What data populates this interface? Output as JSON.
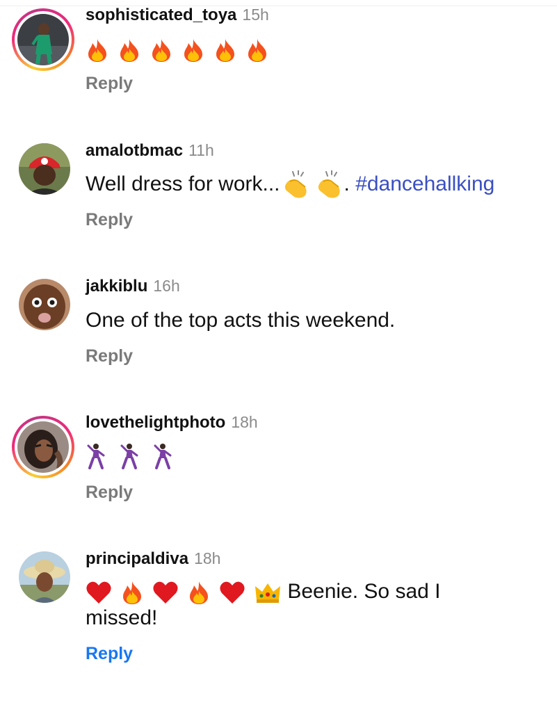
{
  "comments": [
    {
      "username": "sophisticated_toya",
      "time": "15h",
      "text": "",
      "emoji": [
        "fire-icon",
        "fire-icon",
        "fire-icon",
        "fire-icon",
        "fire-icon",
        "fire-icon"
      ],
      "reply": "Reply",
      "story_ring": true
    },
    {
      "username": "amalotbmac",
      "time": "11h",
      "text": "Well dress for work...",
      "text_after_emoji": ". ",
      "hashtag": "#dancehallking",
      "emoji": [
        "clapping-hands-icon",
        "clapping-hands-icon"
      ],
      "reply": "Reply",
      "story_ring": false
    },
    {
      "username": "jakkiblu",
      "time": "16h",
      "text": "One of the top acts this weekend.",
      "reply": "Reply",
      "story_ring": false
    },
    {
      "username": "lovethelightphoto",
      "time": "18h",
      "text": "",
      "emoji": [
        "man-dancing-icon",
        "man-dancing-icon",
        "man-dancing-icon"
      ],
      "reply": "Reply",
      "story_ring": true
    },
    {
      "username": "principaldiva",
      "time": "18h",
      "emoji": [
        "red-heart-icon",
        "fire-icon",
        "red-heart-icon",
        "fire-icon",
        "red-heart-icon",
        "crown-icon"
      ],
      "text": " Beenie. So sad I",
      "text_line2": "missed!",
      "reply": "Reply",
      "story_ring": false,
      "reply_active": true
    }
  ],
  "colors": {
    "username": "#111111",
    "time": "#8a8a8a",
    "reply": "#7a7a7a",
    "reply_active": "#1877f2",
    "hashtag": "#3a4fc2"
  }
}
